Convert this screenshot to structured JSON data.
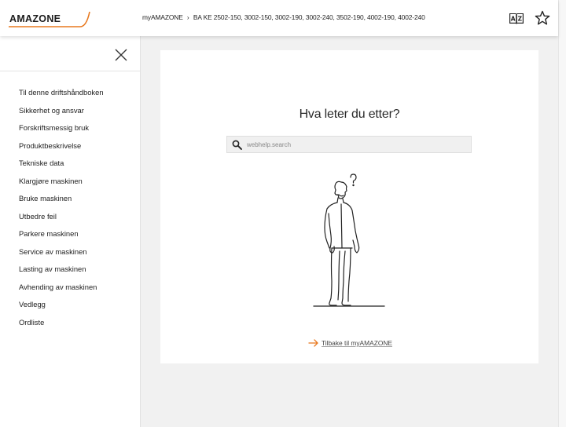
{
  "header": {
    "logo_text": "AMAZONE",
    "breadcrumb": {
      "root": "myAMAZONE",
      "separator": "›",
      "current": "BA KE 2502-150, 3002-150, 3002-190, 3002-240, 3502-190, 4002-190, 4002-240"
    },
    "icons": [
      "glossary-icon",
      "favorite-star-icon"
    ]
  },
  "sidebar": {
    "items": [
      {
        "label": "Til denne driftshåndboken"
      },
      {
        "label": "Sikkerhet og ansvar"
      },
      {
        "label": "Forskriftsmessig bruk"
      },
      {
        "label": "Produktbeskrivelse"
      },
      {
        "label": "Tekniske data"
      },
      {
        "label": "Klargjøre maskinen"
      },
      {
        "label": "Bruke maskinen"
      },
      {
        "label": "Utbedre feil"
      },
      {
        "label": "Parkere maskinen"
      },
      {
        "label": "Service av maskinen"
      },
      {
        "label": "Lasting av maskinen"
      },
      {
        "label": "Avhending av maskinen"
      },
      {
        "label": "Vedlegg"
      },
      {
        "label": "Ordliste"
      }
    ]
  },
  "main": {
    "heading": "Hva leter du etter?",
    "search": {
      "placeholder": "webhelp.search",
      "value": ""
    },
    "back_link": "Tilbake til myAMAZONE"
  },
  "colors": {
    "accent": "#e8781e",
    "background": "#f1f1f1",
    "card": "#ffffff"
  }
}
